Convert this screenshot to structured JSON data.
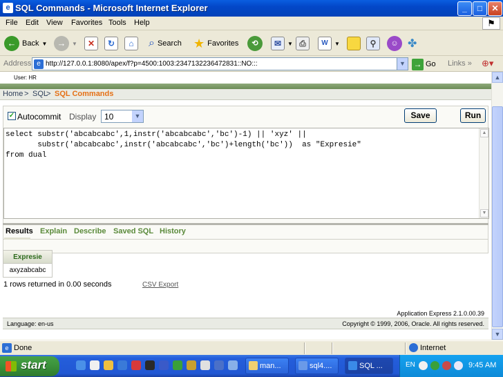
{
  "window": {
    "title": "SQL Commands - Microsoft Internet Explorer"
  },
  "menu": [
    "File",
    "Edit",
    "View",
    "Favorites",
    "Tools",
    "Help"
  ],
  "toolbar": {
    "back": "Back",
    "search": "Search",
    "favorites": "Favorites"
  },
  "address": {
    "label": "Address",
    "url": "http://127.0.0.1:8080/apex/f?p=4500:1003:2347132236472831::NO:::",
    "go": "Go",
    "links": "Links"
  },
  "page": {
    "user": "User: HR",
    "breadcrumb": {
      "home": "Home",
      "sep1": " > ",
      "sql": "SQL",
      "sep2": " > ",
      "current": "SQL Commands"
    },
    "autocommit_label": "Autocommit",
    "autocommit_checked": true,
    "display_label": "Display",
    "display_value": "10",
    "save_label": "Save",
    "run_label": "Run",
    "sql_text": "select substr('abcabcabc',1,instr('abcabcabc','bc')-1) || 'xyz' ||\n       substr('abcabcabc',instr('abcabcabc','bc')+length('bc'))  as \"Expresie\"\nfrom dual",
    "tabs": [
      "Results",
      "Explain",
      "Describe",
      "Saved SQL",
      "History"
    ],
    "results": {
      "column": "Expresie",
      "value": "axyzabcabc"
    },
    "rows_info": "1 rows returned in 0.00 seconds",
    "csv_export": "CSV Export",
    "app_version": "Application Express 2.1.0.00.39",
    "language": "Language: en-us",
    "copyright": "Copyright © 1999, 2006, Oracle. All rights reserved."
  },
  "status": {
    "text": "Done",
    "zone": "Internet"
  },
  "taskbar": {
    "start": "start",
    "tasks": [
      "man...",
      "sql4....",
      "SQL ..."
    ],
    "lang": "EN",
    "clock": "9:45 AM"
  }
}
